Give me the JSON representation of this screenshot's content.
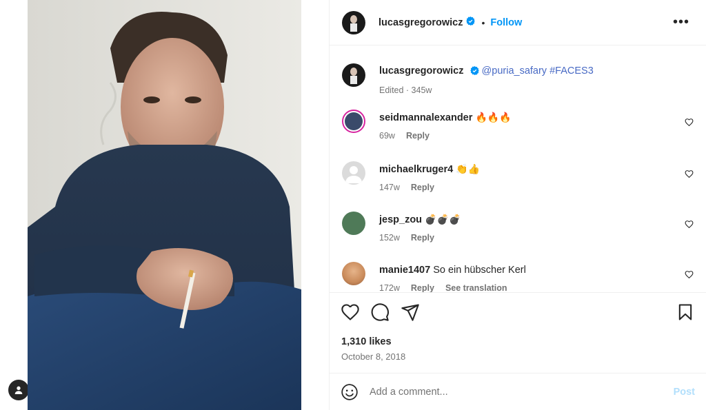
{
  "post": {
    "author": "lucasgregorowicz",
    "follow_label": "Follow",
    "more_label": "•••",
    "dot": "•"
  },
  "caption": {
    "username": "lucasgregorowicz",
    "text": "@puria_safary #FACES3",
    "meta": "Edited · 345w"
  },
  "comments": [
    {
      "username": "seidmannalexander",
      "text": "🔥🔥🔥",
      "age": "69w",
      "reply_label": "Reply",
      "avatar_color": "#3a4a6a"
    },
    {
      "username": "michaelkruger4",
      "text": "👏👍",
      "age": "147w",
      "reply_label": "Reply",
      "avatar_color": "#dbdbdb"
    },
    {
      "username": "jesp_zou",
      "text": "💣💣💣",
      "age": "152w",
      "reply_label": "Reply",
      "avatar_color": "#4f7a58"
    },
    {
      "username": "manie1407",
      "text": "So ein hübscher Kerl",
      "age": "172w",
      "reply_label": "Reply",
      "translate_label": "See translation",
      "avatar_color": "#c98a5a"
    }
  ],
  "stats": {
    "likes": "1,310 likes",
    "date": "October 8, 2018"
  },
  "composer": {
    "placeholder": "Add a comment...",
    "post_label": "Post"
  },
  "colors": {
    "accent": "#0095f6",
    "verified": "#0095f6",
    "muted": "#737373",
    "border": "#efefef"
  },
  "icons": [
    "user-icon",
    "verified-icon",
    "more-icon",
    "heart-icon",
    "comment-icon",
    "share-icon",
    "bookmark-icon",
    "emoji-icon"
  ]
}
